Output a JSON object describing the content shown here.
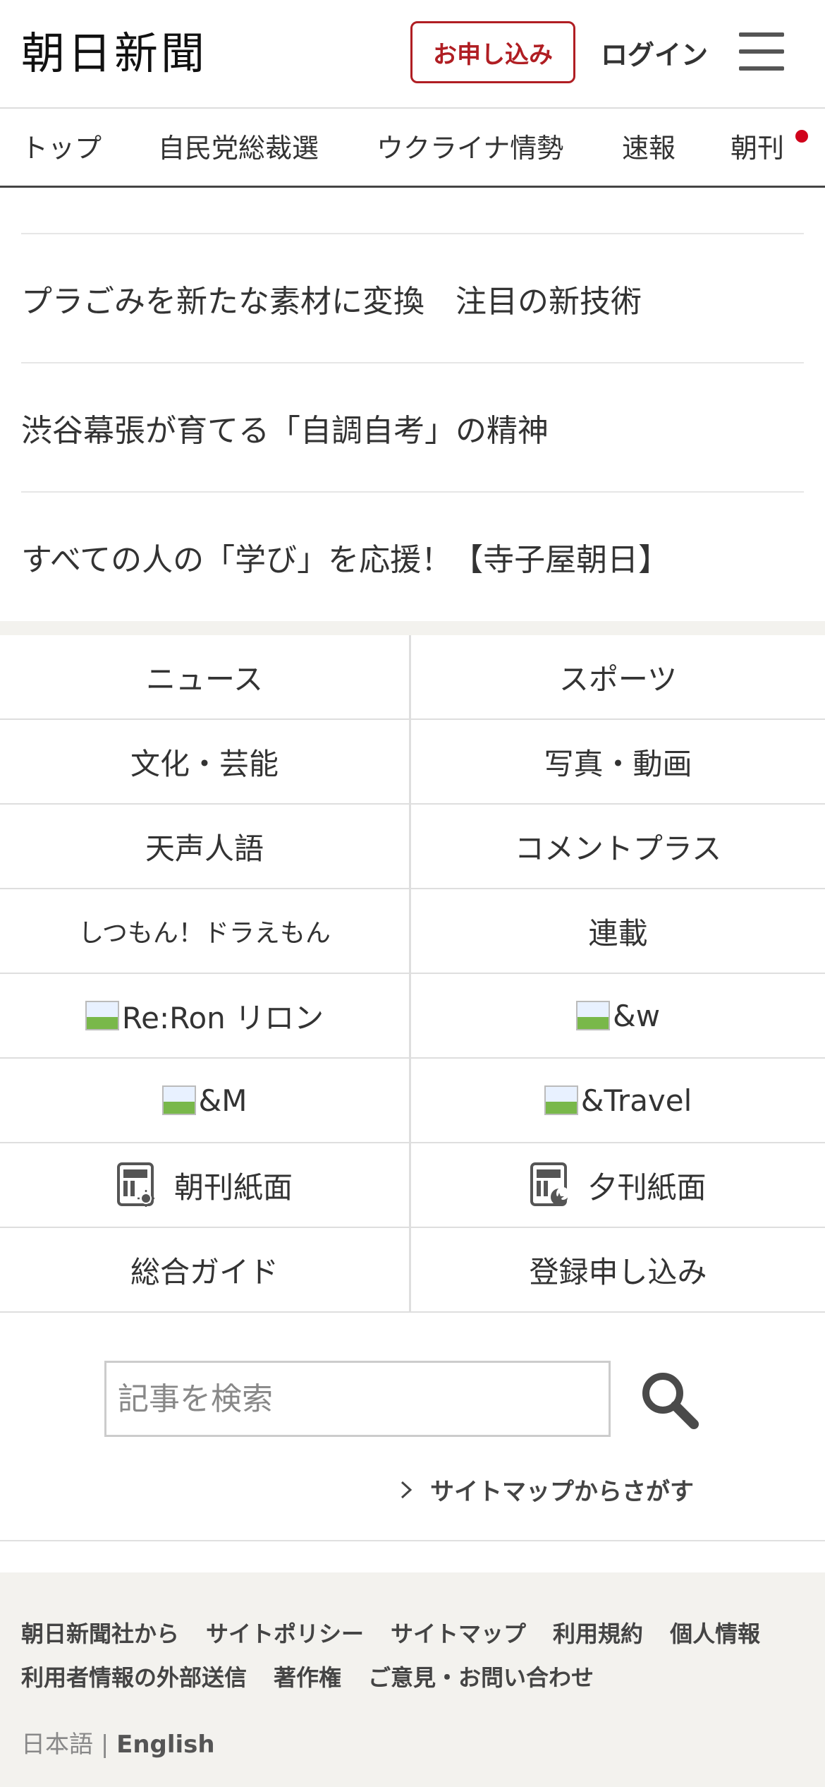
{
  "header": {
    "logo": "朝日新聞",
    "signup_label": "お申し込み",
    "login_label": "ログイン",
    "menu_icon": "hamburger-menu-icon"
  },
  "nav": {
    "items": [
      "トップ",
      "自民党総裁選",
      "ウクライナ情勢",
      "速報",
      "朝刊"
    ],
    "accent_color": "#d0021b"
  },
  "links": [
    "プラごみを新たな素材に変換　注目の新技術",
    "渋谷幕張が育てる「自調自考」の精神",
    "すべての人の「学び」を応援！【寺子屋朝日】"
  ],
  "grid": {
    "cells": [
      "ニュース",
      "スポーツ",
      "文化・芸能",
      "写真・動画",
      "天声人語",
      "コメントプラス",
      "しつもん！ドラえもん",
      "連載",
      "Re:Ron リロン",
      "&w",
      "&M",
      "&Travel",
      "朝刊紙面",
      "夕刊紙面",
      "総合ガイド",
      "登録申し込み"
    ]
  },
  "search": {
    "placeholder": "記事を検索",
    "sitemap_label": "サイトマップからさがす"
  },
  "footer": {
    "links": [
      "朝日新聞社から",
      "サイトポリシー",
      "サイトマップ",
      "利用規約",
      "個人情報",
      "利用者情報の外部送信",
      "著作権",
      "ご意見・お問い合わせ"
    ],
    "lang_ja": "日本語",
    "lang_sep": "|",
    "lang_en": "English"
  },
  "colors": {
    "brand_red": "#b01e23",
    "footer_bg": "#f3f2ee"
  }
}
